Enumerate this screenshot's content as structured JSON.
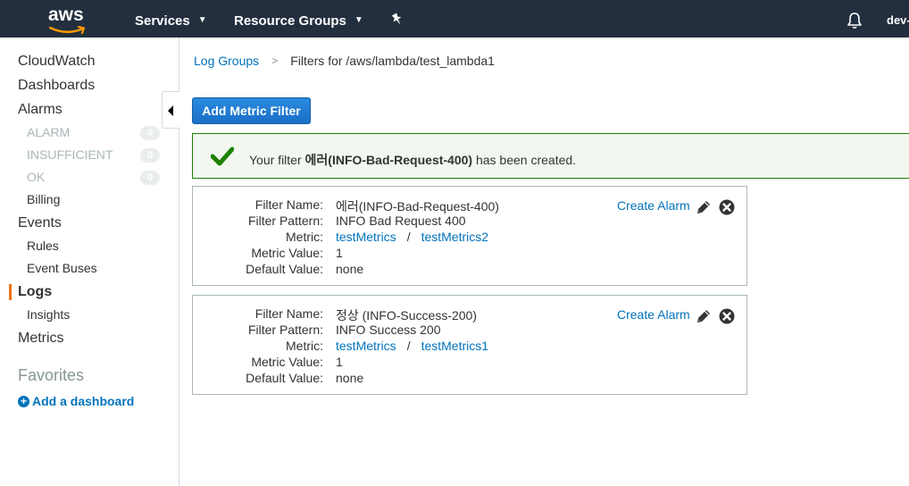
{
  "topnav": {
    "logo_text": "aws",
    "services_label": "Services",
    "resource_groups_label": "Resource Groups",
    "account_label": "dev-"
  },
  "sidebar": {
    "cloudwatch": "CloudWatch",
    "dashboards": "Dashboards",
    "alarms": "Alarms",
    "alarm_states": [
      {
        "label": "ALARM",
        "count": "0"
      },
      {
        "label": "INSUFFICIENT",
        "count": "0"
      },
      {
        "label": "OK",
        "count": "0"
      }
    ],
    "billing": "Billing",
    "events": "Events",
    "rules": "Rules",
    "event_buses": "Event Buses",
    "logs": "Logs",
    "insights": "Insights",
    "metrics": "Metrics",
    "favorites": "Favorites",
    "add_dashboard": "Add a dashboard"
  },
  "breadcrumb": {
    "parent": "Log Groups",
    "separator": ">",
    "current": "Filters for /aws/lambda/test_lambda1"
  },
  "add_metric_filter_label": "Add Metric Filter",
  "alert": {
    "prefix": "Your filter ",
    "filter_name": "에러(INFO-Bad-Request-400)",
    "suffix": " has been created."
  },
  "labels": {
    "filter_name": "Filter Name:",
    "filter_pattern": "Filter Pattern:",
    "metric": "Metric:",
    "metric_value": "Metric Value:",
    "default_value": "Default Value:",
    "create_alarm": "Create Alarm",
    "slash": "/"
  },
  "filters": [
    {
      "name": "에러(INFO-Bad-Request-400)",
      "pattern": "INFO Bad Request 400",
      "namespace": "testMetrics",
      "metric": "testMetrics2",
      "metric_value": "1",
      "default_value": "none"
    },
    {
      "name": "정상 (INFO-Success-200)",
      "pattern": "INFO Success 200",
      "namespace": "testMetrics",
      "metric": "testMetrics1",
      "metric_value": "1",
      "default_value": "none"
    }
  ],
  "colors": {
    "nav_bg": "#232f3e",
    "link": "#0073bb",
    "success": "#1d8102",
    "active_marker": "#ec7211",
    "primary_button": "#1a6fc6"
  }
}
